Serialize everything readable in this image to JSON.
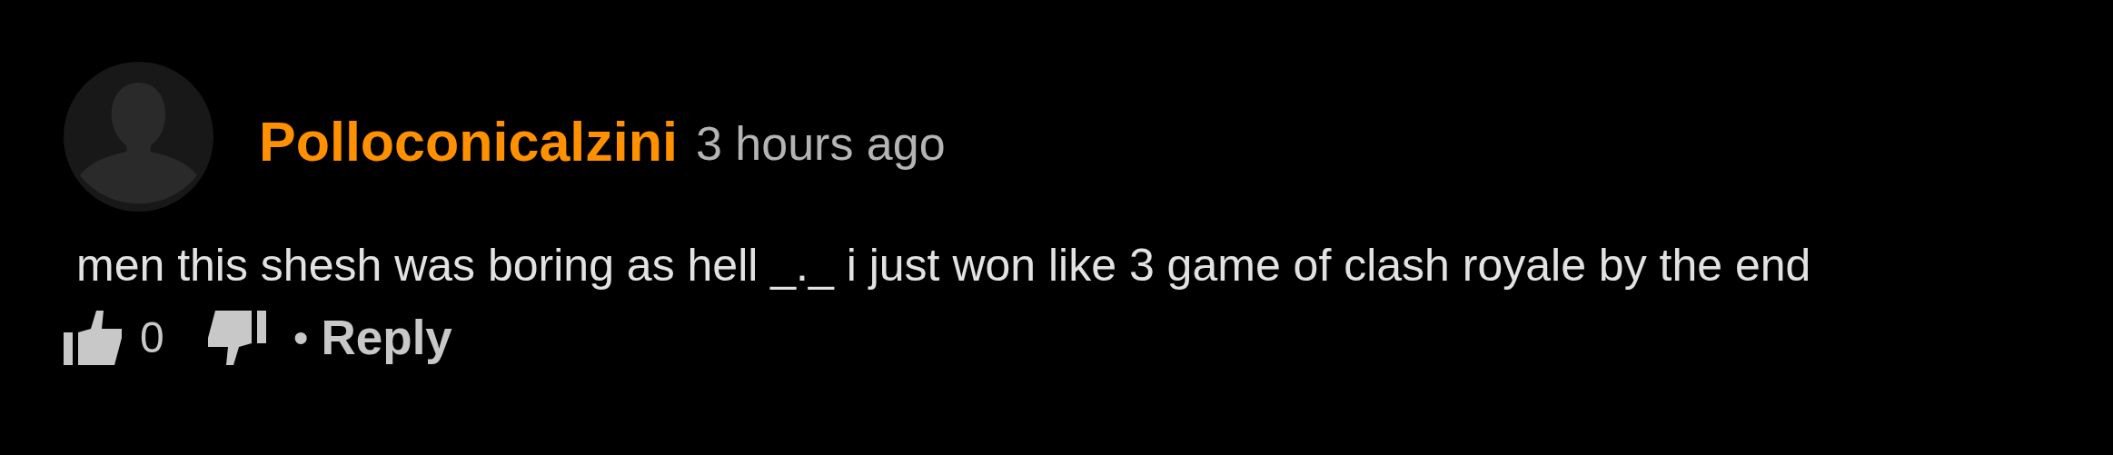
{
  "comment": {
    "author": "Polloconicalzini",
    "time": "3 hours ago",
    "text": "men this shesh was boring as hell _._ i just won like 3 game of clash royale by the end",
    "likes": "0",
    "separator": "•",
    "reply": "Reply"
  }
}
